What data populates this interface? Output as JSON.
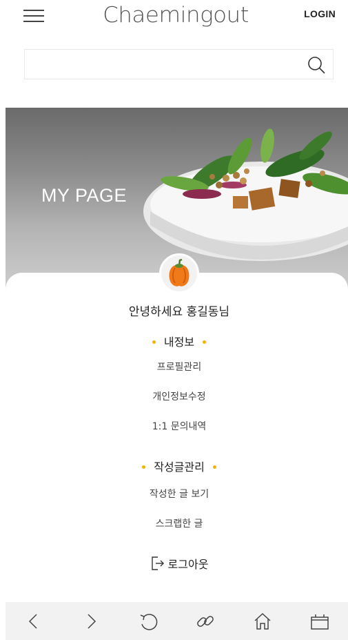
{
  "header": {
    "logo": "Chaemingout",
    "login_label": "LOGIN"
  },
  "search": {
    "placeholder": "",
    "value": ""
  },
  "hero": {
    "title": "MY PAGE"
  },
  "profile": {
    "greeting": "안녕하세요 홍길동님"
  },
  "sections": {
    "my_info": {
      "title": "내정보",
      "items": [
        "프로필관리",
        "개인정보수정",
        "1:1 문의내역"
      ]
    },
    "posts": {
      "title": "작성글관리",
      "items": [
        "작성한 글 보기",
        "스크랩한 글"
      ]
    }
  },
  "logout": {
    "label": "로그아웃"
  },
  "colors": {
    "accent_dot": "#f3b300",
    "toolbar_bg": "#f2f2f2"
  },
  "toolbar": {
    "icons": [
      "back-icon",
      "forward-icon",
      "refresh-icon",
      "link-icon",
      "home-icon",
      "tabs-icon"
    ]
  }
}
